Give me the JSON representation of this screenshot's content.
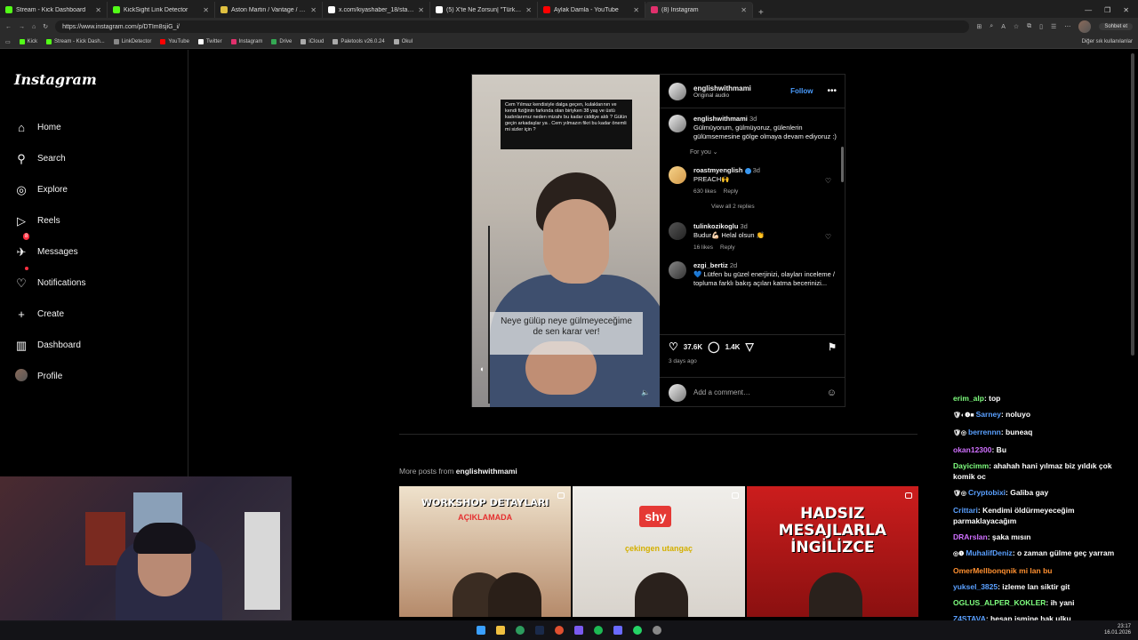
{
  "browser": {
    "tabs": [
      {
        "title": "Stream - Kick Dashboard",
        "color": "#53fc18"
      },
      {
        "title": "KickSight Link Detector",
        "color": "#53fc18"
      },
      {
        "title": "Aston Martin / Vantage / V8 Vanta",
        "color": "#e0c040"
      },
      {
        "title": "x.com/kiyashaber_18/status/2009...",
        "color": "#ffffff"
      },
      {
        "title": "(5) X'te Ne Zorsun| \"Türkiye'nin en",
        "color": "#ffffff"
      },
      {
        "title": "Aylak Damla - YouTube",
        "color": "#ff0000"
      },
      {
        "title": "(8) Instagram",
        "color": "#e1306c"
      }
    ],
    "new_tab": "+",
    "url": "https://www.instagram.com/p/DTIm8sjiG_i/",
    "chat_button": "Sohbet et",
    "bookmarks": [
      {
        "label": "Kick",
        "color": "#53fc18"
      },
      {
        "label": "Stream - Kick Dash...",
        "color": "#53fc18"
      },
      {
        "label": "LinkDetector",
        "color": "#888888"
      },
      {
        "label": "YouTube",
        "color": "#ff0000"
      },
      {
        "label": "Twitter",
        "color": "#ffffff"
      },
      {
        "label": "Instagram",
        "color": "#e1306c"
      },
      {
        "label": "Drive",
        "color": "#34a853"
      },
      {
        "label": "iCloud",
        "color": "#aaaaaa"
      },
      {
        "label": "Paletools v26.0.24",
        "color": "#aaaaaa"
      },
      {
        "label": "Okul",
        "color": "#aaaaaa"
      }
    ],
    "other_bookmarks": "Diğer sık kullanılanlar"
  },
  "sidebar": {
    "logo": "Instagram",
    "items": [
      {
        "label": "Home",
        "icon": "⌂"
      },
      {
        "label": "Search",
        "icon": "⚲"
      },
      {
        "label": "Explore",
        "icon": "◎"
      },
      {
        "label": "Reels",
        "icon": "▷"
      },
      {
        "label": "Messages",
        "icon": "✈",
        "badge": "8"
      },
      {
        "label": "Notifications",
        "icon": "♡"
      },
      {
        "label": "Create",
        "icon": "+"
      },
      {
        "label": "Dashboard",
        "icon": "▥"
      },
      {
        "label": "Profile",
        "icon": ""
      }
    ]
  },
  "post": {
    "caption_box": "Cem Yılmaz kendisiyle dalga geçen, kulaklarının ve kendi fiziğinin farkında olan biriyken 38 yaş ve üstü kadınlarımız neden mizahı bu kadar ciddiye aldı ? Gülün geçin arkadaşlar ya . Cem yılmazın fikri bu kadar önemli mi sizler için ?",
    "overlay_text": "Neye gülüp neye gülmeyeceğime de sen karar ver!",
    "author": "englishwithmami",
    "audio": "Original audio",
    "follow": "Follow",
    "more": "•••",
    "comments": [
      {
        "user": "englishwithmami",
        "time": "3d",
        "text": "Gülmüyorum, gülmüyoruz, gülenlerin gülümsemesine gölge olmaya devam ediyoruz :)"
      },
      {
        "user": "roastmyenglish",
        "time": "3d",
        "text": "PREACH🙌",
        "likes": "630 likes",
        "reply": "Reply",
        "view_replies": "View all 2 replies"
      },
      {
        "user": "tulinkozikoglu",
        "time": "3d",
        "text": "Budur💪🏻 Helal olsun 👏",
        "likes": "16 likes",
        "reply": "Reply"
      },
      {
        "user": "ezgi_bertiz",
        "time": "2d",
        "text": "💙 Lütfen bu güzel enerjinizi, olayları inceleme / topluma farklı bakış açıları katma becerinizi..."
      }
    ],
    "for_you": "For you ⌄",
    "likes": "37.6K",
    "comment_count": "1.4K",
    "posted": "3 days ago",
    "add_comment": "Add a comment…"
  },
  "more_posts": {
    "prefix": "More posts from ",
    "user": "englishwithmami",
    "tiles": [
      {
        "title": "WORKSHOP DETAYLARI",
        "sub": "AÇIKLAMADA"
      },
      {
        "title": "shy",
        "sub": "çekingen utangaç"
      },
      {
        "title": "HADSIZ MESAJLARLA İNGİLİZCE"
      }
    ]
  },
  "chat": [
    {
      "user": "erim_alp",
      "color": "#7fff7f",
      "text": ": top"
    },
    {
      "user": "Sarney",
      "color": "#5aa0ff",
      "badges": "🛡◐❶■",
      "text": ": noluyo"
    },
    {
      "user": "berrennn",
      "color": "#5aa0ff",
      "badges": "🛡◎",
      "text": ": buneaq"
    },
    {
      "user": "okan12300",
      "color": "#d070ff",
      "text": ": Bu"
    },
    {
      "user": "Dayicimm",
      "color": "#7fff7f",
      "text": ": ahahah hani yılmaz biz yıldık çok komik oc"
    },
    {
      "user": "Cryptobixi",
      "color": "#5aa0ff",
      "badges": "🛡◎",
      "text": ": Galiba gay"
    },
    {
      "user": "Crittari",
      "color": "#5aa0ff",
      "text": ": Kendimi öldürmeyeceğim parmaklayacağım"
    },
    {
      "user": "DRArslan",
      "color": "#d070ff",
      "text": ": şaka mısın"
    },
    {
      "user": "MuhalifDeniz",
      "color": "#5aa0ff",
      "badges": "◎❶",
      "text": ": o zaman gülme geç yarram"
    },
    {
      "user": "OmerMellbonqnik mi lan bu",
      "color": "#ff9030",
      "text": ""
    },
    {
      "user": "yuksel_3825",
      "color": "#5aa0ff",
      "text": ": izleme lan siktir git"
    },
    {
      "user": "OGLUS_ALPER_KOKLER",
      "color": "#7fff7f",
      "text": ": ih yani"
    },
    {
      "user": "Z4STAVA",
      "color": "#5aa0ff",
      "text": ": hesap ismine bak ulku"
    }
  ],
  "taskbar": {
    "time": "23:17",
    "date": "16.01.2026"
  }
}
